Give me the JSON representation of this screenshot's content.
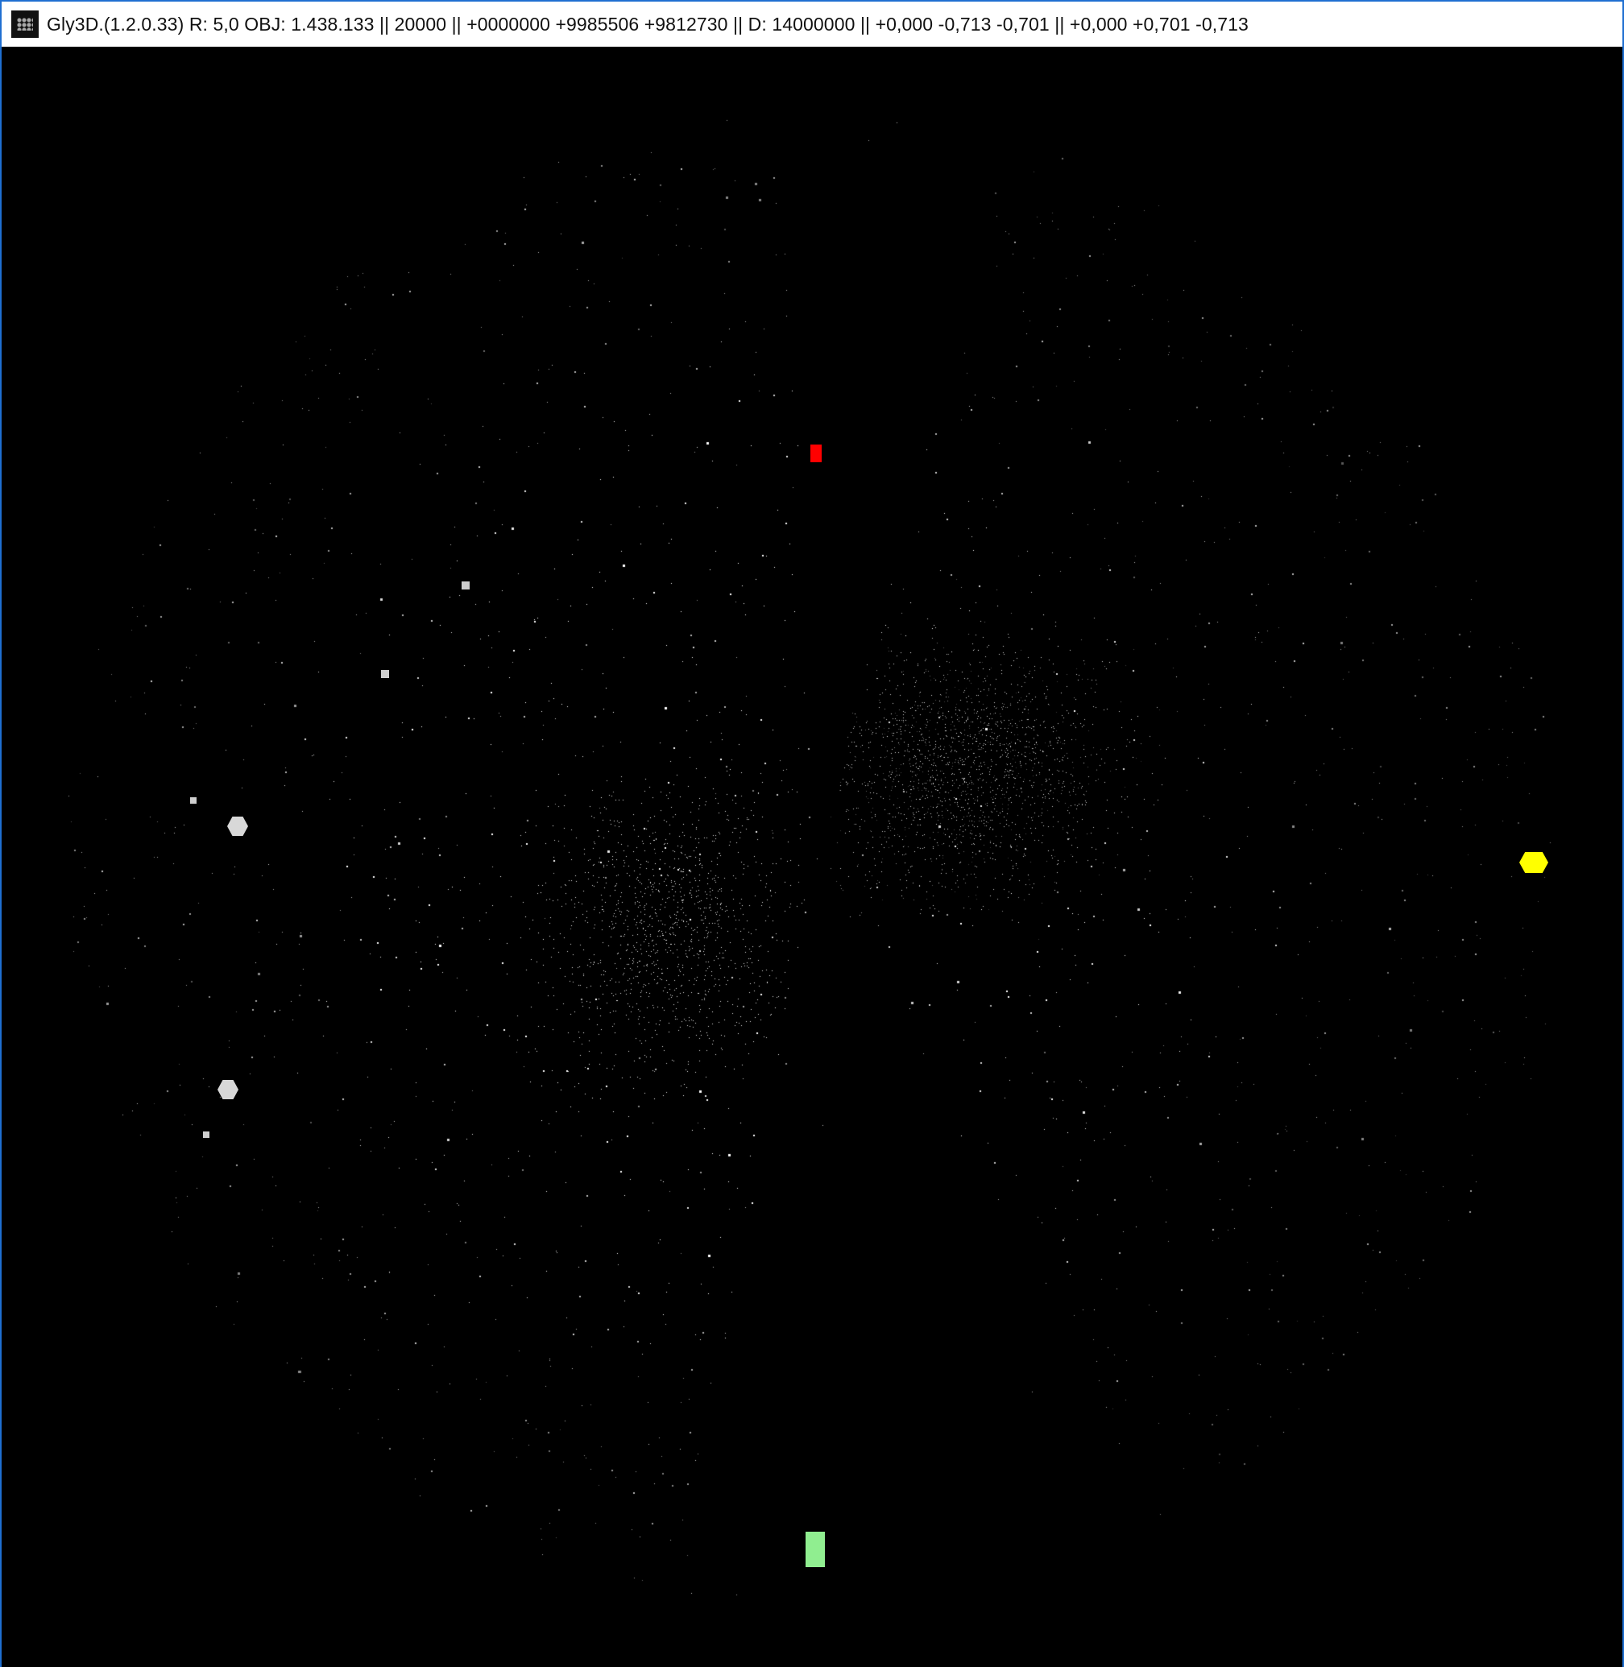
{
  "window": {
    "title": "Gly3D.(1.2.0.33) R: 5,0 OBJ: 1.438.133 || 20000 || +0000000 +9985506 +9812730 || D: 14000000 || +0,000 -0,713 -0,701 || +0,000 +0,701 -0,713",
    "icon": "galaxy-app-icon"
  },
  "colors": {
    "background": "#000000",
    "points": "#ffffff",
    "marker_red": "#ff0000",
    "marker_green": "#90ee90",
    "marker_yellow": "#ffff00",
    "large_objects": "#d8d8d8",
    "window_border": "#1f6fd1"
  }
}
